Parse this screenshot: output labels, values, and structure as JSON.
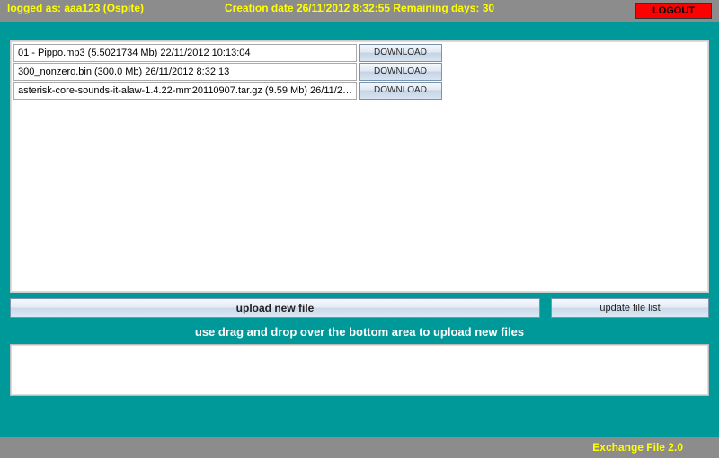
{
  "header": {
    "login_text": "logged as: aaa123 (Ospite)",
    "center_text": "Creation date 26/11/2012 8:32:55 Remaining days: 30",
    "logout_label": "LOGOUT"
  },
  "files": [
    {
      "label": "01 - Pippo.mp3 (5.5021734 Mb) 22/11/2012 10:13:04",
      "btn": "DOWNLOAD"
    },
    {
      "label": "300_nonzero.bin (300.0 Mb) 26/11/2012 8:32:13",
      "btn": "DOWNLOAD"
    },
    {
      "label": "asterisk-core-sounds-it-alaw-1.4.22-mm20110907.tar.gz (9.59 Mb) 26/11/2012 ...",
      "btn": "DOWNLOAD"
    }
  ],
  "buttons": {
    "upload": "upload new file",
    "update": "update file list"
  },
  "drag_hint": "use drag and drop over the bottom area to upload new files",
  "footer": {
    "brand": "Exchange File 2.0"
  }
}
